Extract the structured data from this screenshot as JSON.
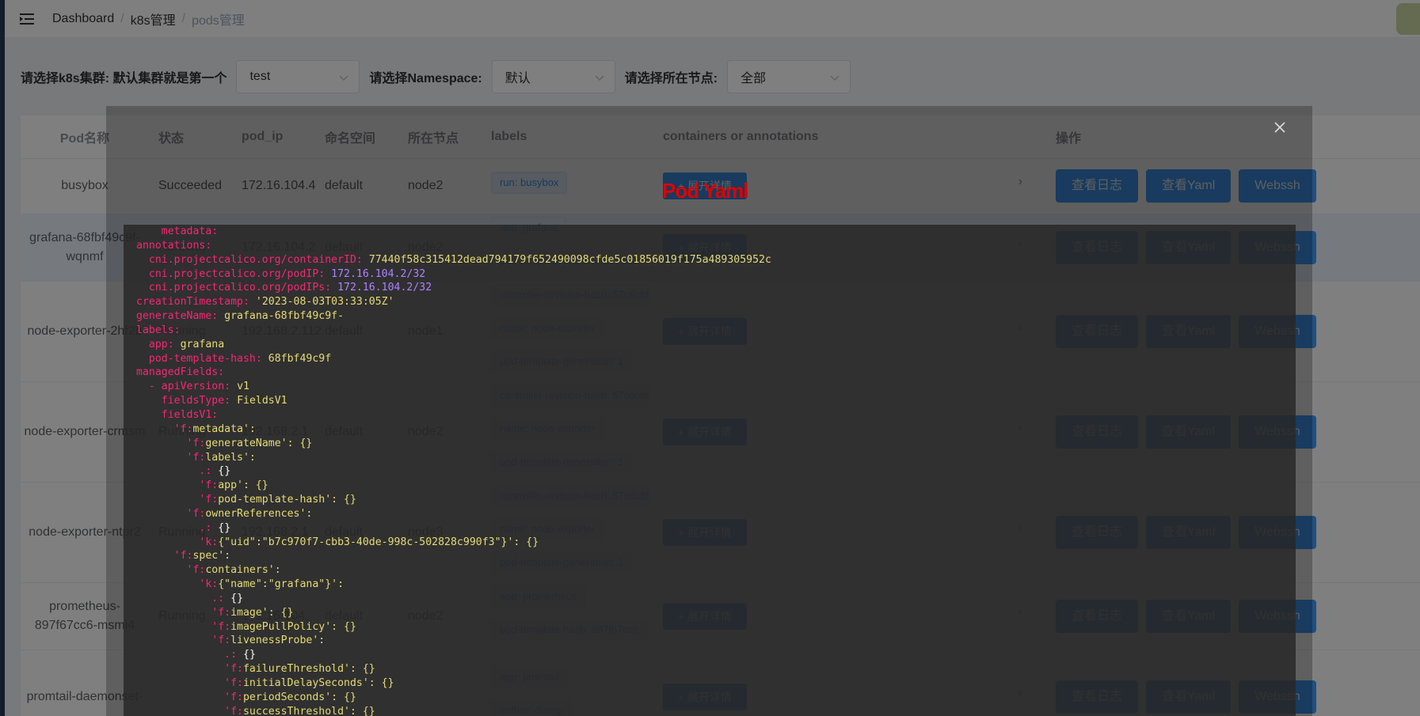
{
  "breadcrumb": [
    "Dashboard",
    "k8s管理",
    "pods管理"
  ],
  "filters": {
    "cluster_label": "请选择k8s集群: 默认集群就是第一个",
    "cluster_value": "test",
    "namespace_label": "请选择Namespace:",
    "namespace_value": "默认",
    "node_label": "请选择所在节点:",
    "node_value": "全部"
  },
  "table": {
    "headers": [
      "Pod名称",
      "状态",
      "pod_ip",
      "命名空间",
      "所在节点",
      "labels",
      "containers or annotations",
      "操作"
    ],
    "expand_label": "+ 展开详情",
    "buttons": {
      "log": "查看日志",
      "yaml": "查看Yaml",
      "webssh": "Webssh"
    },
    "rows": [
      {
        "name": "busybox",
        "status": "Succeeded",
        "ip": "172.16.104.4",
        "ns": "default",
        "node": "node2",
        "labels": [
          "run: busybox"
        ]
      },
      {
        "name": "grafana-68fbf49c9f-wqnmf",
        "status": "Running",
        "ip": "172.16.104.2",
        "ns": "default",
        "node": "node2",
        "labels": [
          "app: grafana",
          "pod-template-hash: 68fbf49c9f"
        ]
      },
      {
        "name": "node-exporter-2hf2b",
        "status": "Running",
        "ip": "192.168.2.112",
        "ns": "default",
        "node": "node1",
        "labels": [
          "controller-revision-hash: 57c6c8f",
          "name: node-exporter",
          "pod-template-generation: 1"
        ]
      },
      {
        "name": "node-exporter-crmsm",
        "status": "Running",
        "ip": "192.168.2.1",
        "ns": "default",
        "node": "node2",
        "labels": [
          "controller-revision-hash: 57c6c8f",
          "name: node-exporter",
          "pod-template-generation: 1"
        ]
      },
      {
        "name": "node-exporter-ntpr2",
        "status": "Running",
        "ip": "192.168.2.1",
        "ns": "default",
        "node": "node3",
        "labels": [
          "controller-revision-hash: 57c6c8f",
          "name: node-exporter",
          "pod-template-generation: 1"
        ]
      },
      {
        "name": "prometheus-897f67cc6-msml4",
        "status": "Running",
        "ip": "172.16.104.",
        "ns": "default",
        "node": "node2",
        "labels": [
          "app: prometheus",
          "pod-template-hash: 897f67cc6"
        ]
      },
      {
        "name": "promtail-daemonset-",
        "status": "",
        "ip": "",
        "ns": "",
        "node": "",
        "labels": [
          "app: promtail",
          "author: danny"
        ]
      }
    ]
  },
  "dialog": {
    "title": "Pod Yaml",
    "yaml_lines": [
      "    metadata:",
      "annotations:",
      "  cni.projectcalico.org/containerID: 77440f58c315412dead794179f652490098cfde5c01856019f175a489305952c",
      "  cni.projectcalico.org/podIP: 172.16.104.2/32",
      "  cni.projectcalico.org/podIPs: 172.16.104.2/32",
      "creationTimestamp: '2023-08-03T03:33:05Z'",
      "generateName: grafana-68fbf49c9f-",
      "labels:",
      "  app: grafana",
      "  pod-template-hash: 68fbf49c9f",
      "managedFields:",
      "  - apiVersion: v1",
      "    fieldsType: FieldsV1",
      "    fieldsV1:",
      "      'f:metadata':",
      "        'f:generateName': {}",
      "        'f:labels':",
      "          .: {}",
      "          'f:app': {}",
      "          'f:pod-template-hash': {}",
      "        'f:ownerReferences':",
      "          .: {}",
      "          'k:{\"uid\":\"b7c970f7-cbb3-40de-998c-502828c990f3\"}': {}",
      "      'f:spec':",
      "        'f:containers':",
      "          'k:{\"name\":\"grafana\"}':",
      "            .: {}",
      "            'f:image': {}",
      "            'f:imagePullPolicy': {}",
      "            'f:livenessProbe':",
      "              .: {}",
      "              'f:failureThreshold': {}",
      "              'f:initialDelaySeconds': {}",
      "              'f:periodSeconds': {}",
      "              'f:successThreshold': {}"
    ]
  },
  "colors": {
    "primary": "#409eff",
    "yaml_key": "#f92672",
    "yaml_string": "#e6db74",
    "yaml_number": "#ae81ff",
    "title_red": "#e00000"
  }
}
